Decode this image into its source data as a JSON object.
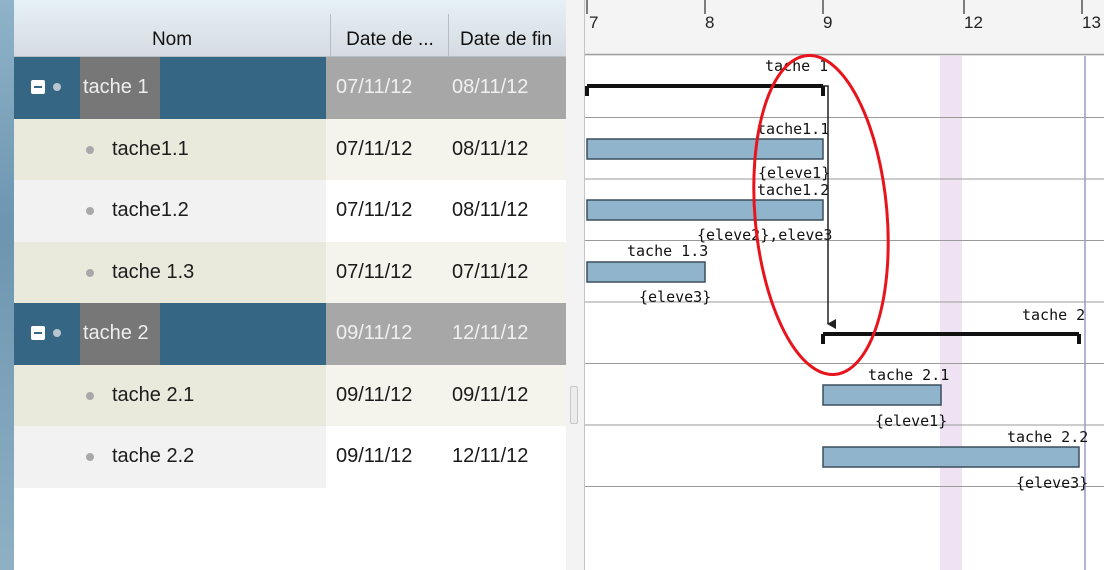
{
  "task_table": {
    "headers": {
      "name": "Nom",
      "start": "Date de ...",
      "end": "Date de fin"
    },
    "rows": [
      {
        "name": "tache 1",
        "start": "07/11/12",
        "end": "08/11/12",
        "type": "group"
      },
      {
        "name": "tache1.1",
        "start": "07/11/12",
        "end": "08/11/12",
        "type": "alt"
      },
      {
        "name": "tache1.2",
        "start": "07/11/12",
        "end": "08/11/12",
        "type": "plain"
      },
      {
        "name": "tache 1.3",
        "start": "07/11/12",
        "end": "07/11/12",
        "type": "alt"
      },
      {
        "name": "tache 2",
        "start": "09/11/12",
        "end": "12/11/12",
        "type": "group"
      },
      {
        "name": "tache 2.1",
        "start": "09/11/12",
        "end": "09/11/12",
        "type": "alt"
      },
      {
        "name": "tache 2.2",
        "start": "09/11/12",
        "end": "12/11/12",
        "type": "plain"
      }
    ]
  },
  "gantt": {
    "timescale": [
      "7",
      "8",
      "9",
      "12",
      "13"
    ],
    "bars": [
      {
        "label": "tache 1",
        "kind": "summary",
        "resource": ""
      },
      {
        "label": "tache1.1",
        "kind": "task",
        "resource": "{eleve1}"
      },
      {
        "label": "tache1.2",
        "kind": "task",
        "resource": "{eleve2},eleve3"
      },
      {
        "label": "tache 1.3",
        "kind": "task",
        "resource": "{eleve3}"
      },
      {
        "label": "tache 2",
        "kind": "summary",
        "resource": ""
      },
      {
        "label": "tache 2.1",
        "kind": "task",
        "resource": "{eleve1}"
      },
      {
        "label": "tache 2.2",
        "kind": "task",
        "resource": "{eleve3}"
      }
    ],
    "colors": {
      "bar_fill": "#8fb4cc",
      "bar_stroke": "#3a4e5c",
      "annotation": "#e8141c",
      "highlight_column": "#efe3f3",
      "today_line": "#9a9ac8"
    }
  }
}
